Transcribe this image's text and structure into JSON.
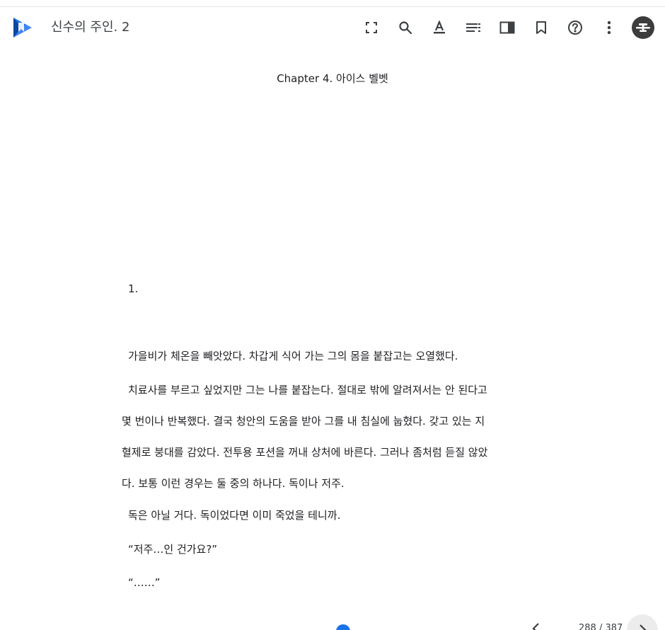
{
  "header": {
    "book_title": "신수의 주인. 2"
  },
  "icons": {
    "logo": "play-books-logo",
    "fullscreen": "fullscreen-icon",
    "search": "search-icon",
    "text_format": "text-format-icon",
    "contents": "table-of-contents-icon",
    "layout": "page-layout-icon",
    "bookmark": "bookmark-icon",
    "help": "help-icon",
    "more": "more-vert-icon"
  },
  "colors": {
    "logo_dark": "#0d47a1",
    "logo_light": "#4285f4",
    "icon": "#3c4043",
    "avatar_bg": "#3c3c3c",
    "progress": "#1a73e8"
  },
  "page": {
    "chapter_title": "Chapter 4. 아이스 벨벳",
    "section_number": "1.",
    "lines": [
      "가을비가 체온을 빼앗았다. 차갑게 식어 가는 그의 몸을 붙잡고는 오열했다.",
      "치료사를 부르고 싶었지만 그는 나를 붙잡는다. 절대로 밖에 알려져서는 안 된다고",
      "몇 번이나 반복했다. 결국 청안의 도움을 받아 그를 내 침실에 눕혔다. 갖고 있는 지",
      "혈제로 붕대를 감았다. 전투용 포션을 꺼내 상처에 바른다. 그러나 좀처럼 듣질 않았",
      "다. 보통 이런 경우는 둘 중의 하나다. 독이나 저주.",
      "독은 아닐 거다. 독이었다면 이미 죽었을 테니까.",
      "“저주…인 건가요?”",
      "“……”"
    ]
  },
  "footer": {
    "page_indicator": "288 / 387"
  }
}
